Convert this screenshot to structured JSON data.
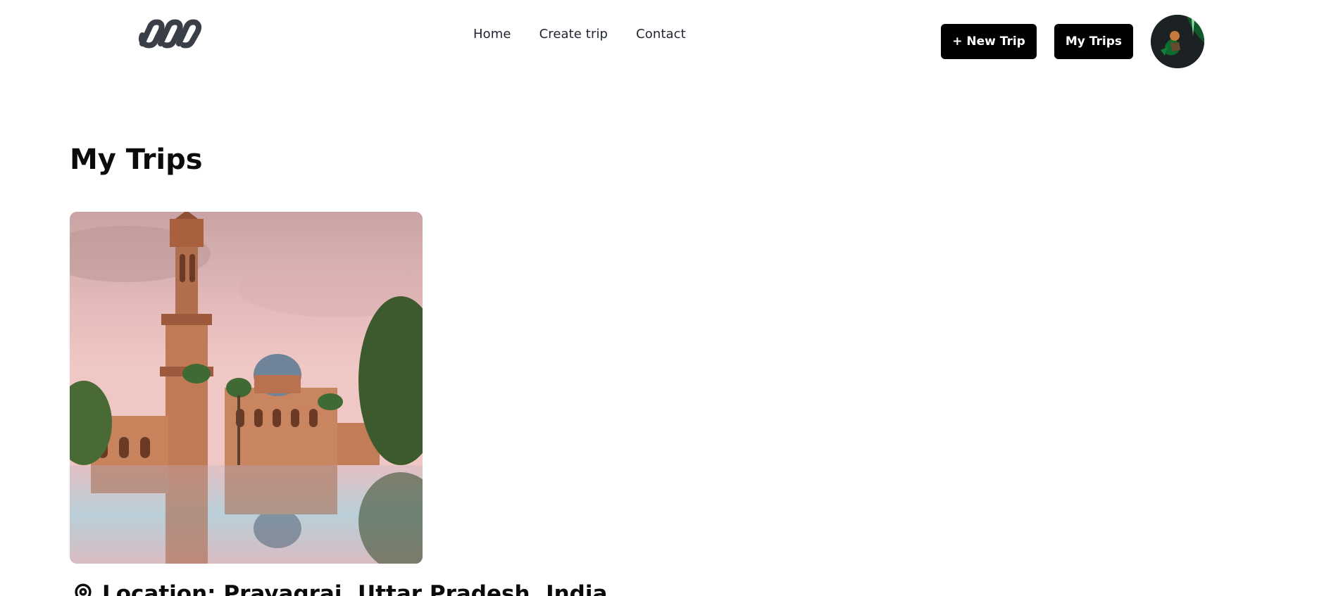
{
  "header": {
    "logo_icon": "chain-link-logo",
    "nav": [
      {
        "label": "Home"
      },
      {
        "label": "Create trip"
      },
      {
        "label": "Contact"
      }
    ],
    "new_trip_label": "+ New Trip",
    "my_trips_label": "My Trips",
    "avatar_icon": "user-avatar"
  },
  "main": {
    "title": "My Trips",
    "trips": [
      {
        "location_icon": "map-pin-icon",
        "location_label": "Location: Prayagraj, Uttar Pradesh, India"
      }
    ]
  },
  "colors": {
    "button_bg": "#000000",
    "button_text": "#ffffff",
    "logo": "#3a3f47"
  }
}
